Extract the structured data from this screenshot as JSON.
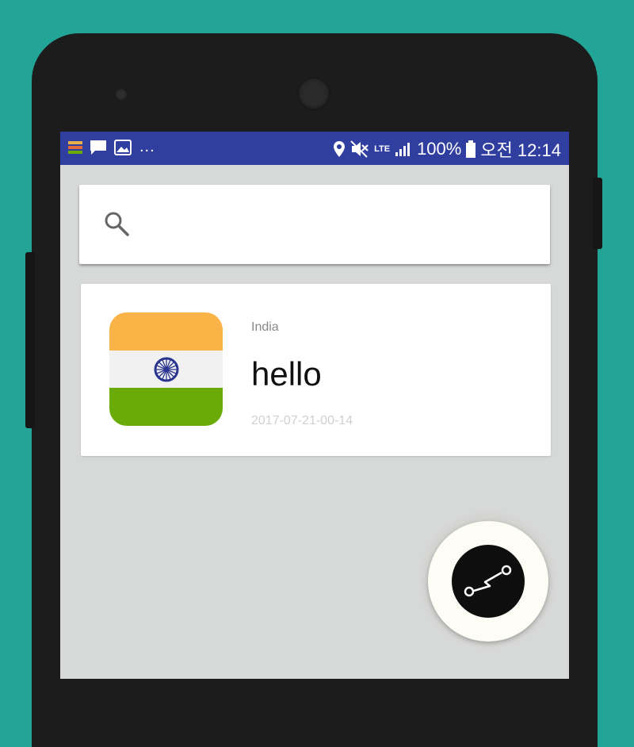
{
  "status_bar": {
    "left_icons": [
      "app-icon",
      "chat-icon",
      "image-icon"
    ],
    "more": "...",
    "lte": "LTE",
    "battery": "100%",
    "time": "오전 12:14"
  },
  "search": {
    "placeholder": ""
  },
  "items": [
    {
      "country": "India",
      "message": "hello",
      "date": "2017-07-21-00-14",
      "flag_icon": "india-flag-icon"
    }
  ],
  "fab": {
    "icon": "route-icon"
  },
  "colors": {
    "background": "#22a597",
    "status_bar": "#2f3e9f",
    "screen": "#d7d8d8",
    "flag_saffron": "#f9b346",
    "flag_white": "#f1f1f1",
    "flag_green": "#6aab08",
    "flag_chakra": "#2a3590"
  }
}
